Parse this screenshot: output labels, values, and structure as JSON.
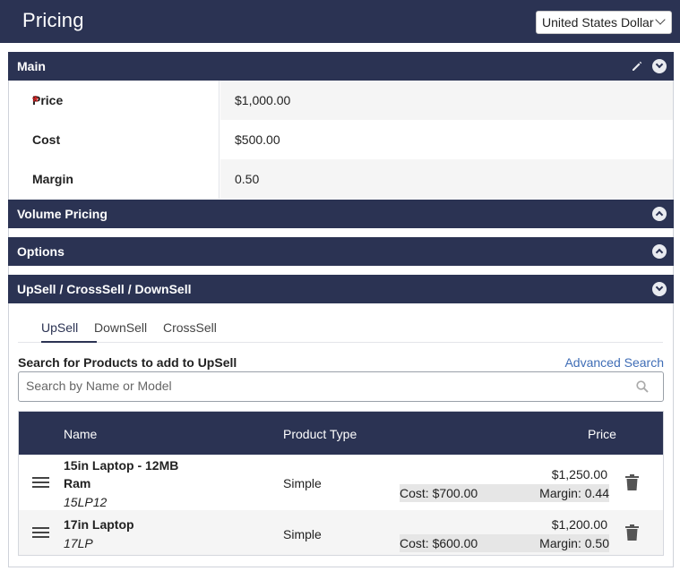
{
  "header": {
    "title": "Pricing",
    "currency": "United States Dollar"
  },
  "sections": {
    "main": {
      "title": "Main",
      "fields": [
        {
          "label": "Price",
          "value": "$1,000.00",
          "required_mark": "*"
        },
        {
          "label": "Cost",
          "value": "$500.00"
        },
        {
          "label": "Margin",
          "value": "0.50"
        }
      ]
    },
    "volume": {
      "title": "Volume Pricing"
    },
    "options": {
      "title": "Options"
    },
    "upsell": {
      "title": "UpSell / CrossSell / DownSell",
      "tabs": [
        "UpSell",
        "DownSell",
        "CrossSell"
      ],
      "active_tab": "UpSell",
      "search_label": "Search for Products to add to UpSell",
      "advanced_search": "Advanced Search",
      "search_placeholder": "Search by Name or Model",
      "table": {
        "columns": [
          "Name",
          "Product Type",
          "Price"
        ],
        "rows": [
          {
            "name_line1": "15in Laptop - 12MB",
            "name_line2": "Ram",
            "model": "15LP12",
            "type": "Simple",
            "price": "$1,250.00",
            "cost": "Cost: $700.00",
            "margin": "Margin: 0.44"
          },
          {
            "name_line1": "17in Laptop",
            "model": "17LP",
            "type": "Simple",
            "price": "$1,200.00",
            "cost": "Cost: $600.00",
            "margin": "Margin: 0.50"
          }
        ]
      }
    }
  },
  "colors": {
    "header_bg": "#2b3353",
    "required": "#c81e1e",
    "link": "#3f6db6"
  },
  "icons": [
    "pencil-icon",
    "chevron-down-icon",
    "chevron-up-icon",
    "search-icon",
    "drag-handle-icon",
    "trash-icon"
  ]
}
